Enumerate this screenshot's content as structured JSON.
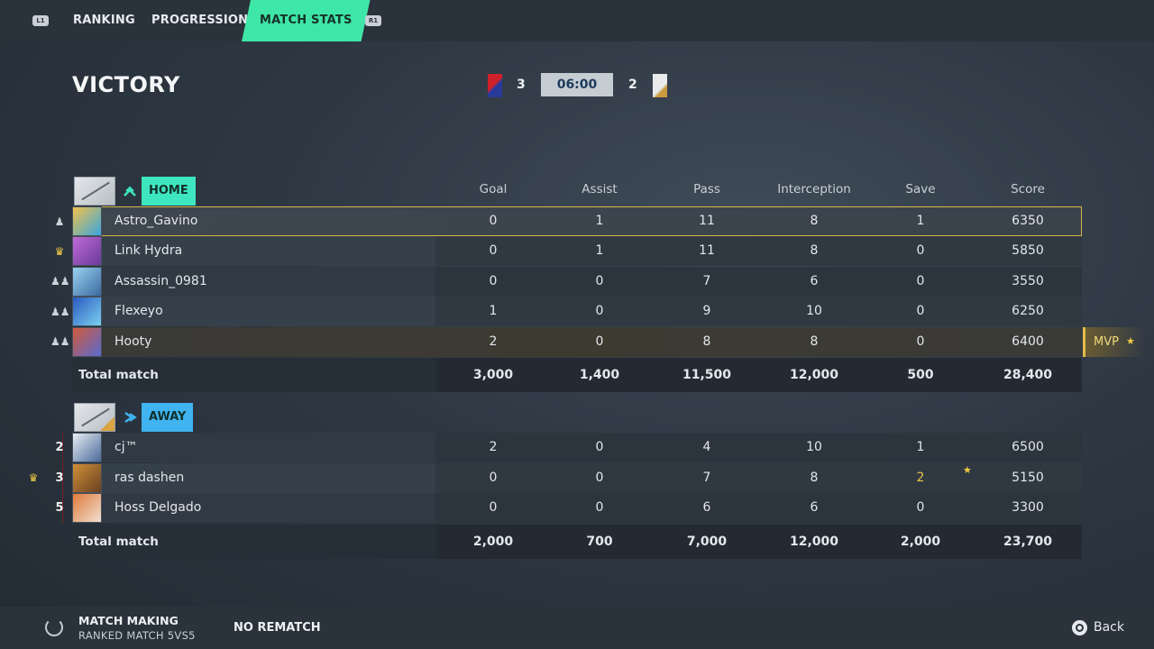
{
  "tabs": {
    "left_hint": "L1",
    "right_hint": "R1",
    "items": [
      {
        "label": "RANKING"
      },
      {
        "label": "PROGRESSION"
      },
      {
        "label": "MATCH STATS"
      }
    ],
    "active": "MATCH STATS"
  },
  "header": {
    "result": "VICTORY",
    "home_score": "3",
    "away_score": "2",
    "timer": "06:00"
  },
  "columns": [
    "Goal",
    "Assist",
    "Pass",
    "Interception",
    "Save",
    "Score"
  ],
  "home": {
    "label": "HOME",
    "color": "#3ee6c0",
    "players": [
      {
        "name": "Astro_Gavino",
        "goal": "0",
        "assist": "1",
        "pass": "11",
        "interception": "8",
        "save": "1",
        "score": "6350"
      },
      {
        "name": "Link Hydra",
        "goal": "0",
        "assist": "1",
        "pass": "11",
        "interception": "8",
        "save": "0",
        "score": "5850"
      },
      {
        "name": "Assassin_0981",
        "goal": "0",
        "assist": "0",
        "pass": "7",
        "interception": "6",
        "save": "0",
        "score": "3550"
      },
      {
        "name": "Flexeyo",
        "goal": "1",
        "assist": "0",
        "pass": "9",
        "interception": "10",
        "save": "0",
        "score": "6250"
      },
      {
        "name": "Hooty",
        "goal": "2",
        "assist": "0",
        "pass": "8",
        "interception": "8",
        "save": "0",
        "score": "6400"
      }
    ],
    "total": {
      "label": "Total match",
      "goal": "3,000",
      "assist": "1,400",
      "pass": "11,500",
      "interception": "12,000",
      "save": "500",
      "score": "28,400"
    }
  },
  "away": {
    "label": "AWAY",
    "color": "#3fb4f0",
    "players": [
      {
        "rank": "2",
        "name": "cj™",
        "goal": "2",
        "assist": "0",
        "pass": "4",
        "interception": "10",
        "save": "1",
        "score": "6500"
      },
      {
        "rank": "3",
        "name": "ras dashen",
        "goal": "0",
        "assist": "0",
        "pass": "7",
        "interception": "8",
        "save": "2",
        "score": "5150"
      },
      {
        "rank": "5",
        "name": "Hoss Delgado",
        "goal": "0",
        "assist": "0",
        "pass": "6",
        "interception": "6",
        "save": "0",
        "score": "3300"
      }
    ],
    "total": {
      "label": "Total match",
      "goal": "2,000",
      "assist": "700",
      "pass": "7,000",
      "interception": "12,000",
      "save": "2,000",
      "score": "23,700"
    }
  },
  "mvp": {
    "label": "MVP"
  },
  "footer": {
    "matchmaking_title": "MATCH MAKING",
    "matchmaking_sub": "RANKED MATCH 5VS5",
    "no_rematch": "NO REMATCH",
    "back": "Back"
  }
}
